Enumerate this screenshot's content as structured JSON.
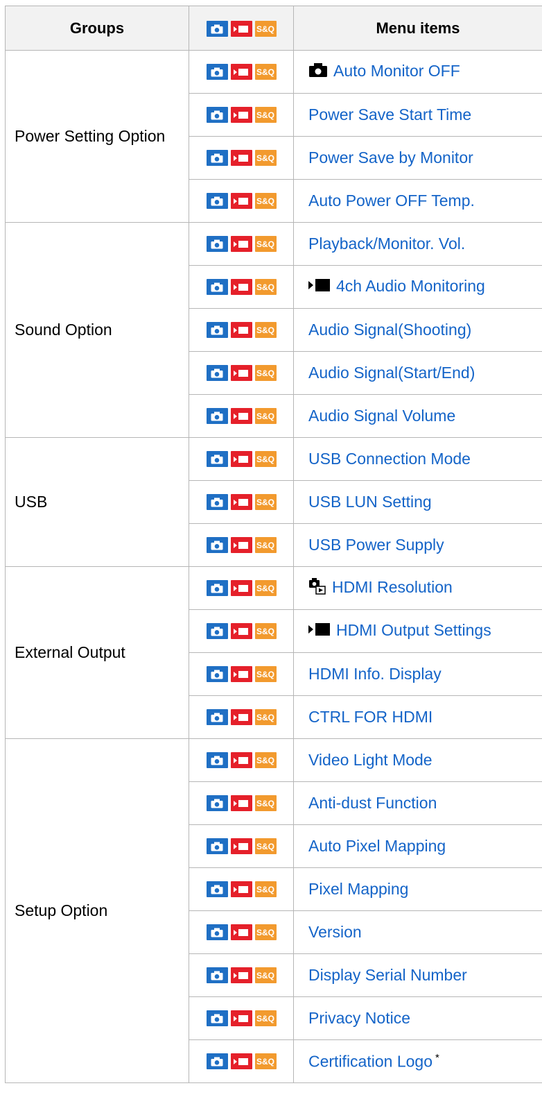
{
  "header": {
    "groups": "Groups",
    "menu_items": "Menu items"
  },
  "icons": {
    "photo": "camera-icon",
    "movie": "movie-icon",
    "sq": "S&Q"
  },
  "colors": {
    "photo": "#1f6fc4",
    "movie": "#e5202a",
    "sq": "#f29a2e",
    "link": "#1464c8"
  },
  "groups": [
    {
      "name": "Power Setting Option",
      "items": [
        {
          "label": "Auto Monitor OFF",
          "prefix": "camera-glyph"
        },
        {
          "label": "Power Save Start Time"
        },
        {
          "label": "Power Save by Monitor"
        },
        {
          "label": "Auto Power OFF Temp."
        }
      ]
    },
    {
      "name": "Sound Option",
      "items": [
        {
          "label": "Playback/Monitor. Vol."
        },
        {
          "label": "4ch Audio Monitoring",
          "prefix": "movie-glyph"
        },
        {
          "label": "Audio Signal(Shooting)"
        },
        {
          "label": "Audio Signal(Start/End)"
        },
        {
          "label": "Audio Signal Volume"
        }
      ]
    },
    {
      "name": "USB",
      "items": [
        {
          "label": "USB Connection Mode"
        },
        {
          "label": "USB LUN Setting"
        },
        {
          "label": "USB Power Supply"
        }
      ]
    },
    {
      "name": "External Output",
      "items": [
        {
          "label": "HDMI Resolution",
          "prefix": "camera-playback-glyph"
        },
        {
          "label": "HDMI Output Settings",
          "prefix": "movie-glyph"
        },
        {
          "label": "HDMI Info. Display"
        },
        {
          "label": "CTRL FOR HDMI"
        }
      ]
    },
    {
      "name": "Setup Option",
      "items": [
        {
          "label": "Video Light Mode"
        },
        {
          "label": "Anti-dust Function"
        },
        {
          "label": "Auto Pixel Mapping"
        },
        {
          "label": "Pixel Mapping"
        },
        {
          "label": "Version"
        },
        {
          "label": "Display Serial Number"
        },
        {
          "label": "Privacy Notice"
        },
        {
          "label": "Certification Logo",
          "note": "*"
        }
      ]
    }
  ]
}
